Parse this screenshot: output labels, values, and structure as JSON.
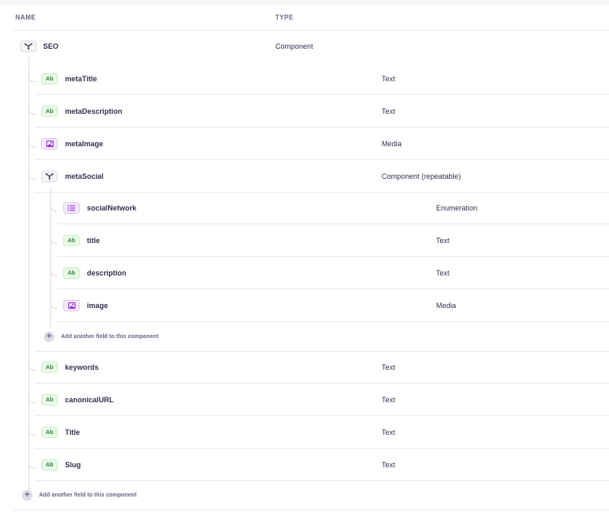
{
  "table": {
    "headers": {
      "name": "NAME",
      "type": "TYPE"
    }
  },
  "root": {
    "name": "SEO",
    "type": "Component",
    "icon": "component-icon"
  },
  "fields": [
    {
      "name": "metaTitle",
      "type": "Text",
      "badge": "Ab",
      "icon": "text-icon"
    },
    {
      "name": "metaDescription",
      "type": "Text",
      "badge": "Ab",
      "icon": "text-icon"
    },
    {
      "name": "metaImage",
      "type": "Media",
      "badge": "",
      "icon": "media-icon"
    },
    {
      "name": "metaSocial",
      "type": "Component (repeatable)",
      "badge": "",
      "icon": "component-icon"
    }
  ],
  "nested_fields": [
    {
      "name": "socialNetwork",
      "type": "Enumeration",
      "badge": "",
      "icon": "enumeration-icon"
    },
    {
      "name": "title",
      "type": "Text",
      "badge": "Ab",
      "icon": "text-icon"
    },
    {
      "name": "description",
      "type": "Text",
      "badge": "Ab",
      "icon": "text-icon"
    },
    {
      "name": "image",
      "type": "Media",
      "badge": "",
      "icon": "media-icon"
    }
  ],
  "nested_add_label": "Add another field to this component",
  "fields_after": [
    {
      "name": "keywords",
      "type": "Text",
      "badge": "Ab",
      "icon": "text-icon"
    },
    {
      "name": "canonicalURL",
      "type": "Text",
      "badge": "Ab",
      "icon": "text-icon"
    },
    {
      "name": "Title",
      "type": "Text",
      "badge": "Ab",
      "icon": "text-icon"
    },
    {
      "name": "Slug",
      "type": "Text",
      "badge": "Ab",
      "icon": "text-icon"
    }
  ],
  "root_add_label": "Add another field to this component",
  "colors": {
    "text_badge": "#328048",
    "media_badge": "#9736e8",
    "line": "#dcdce4"
  }
}
